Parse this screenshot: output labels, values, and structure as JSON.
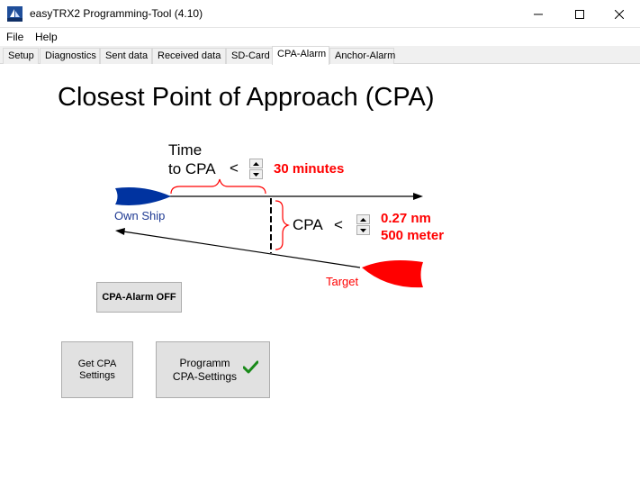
{
  "window": {
    "title": "easyTRX2 Programming-Tool (4.10)",
    "icon": "trx-app-icon"
  },
  "menu": [
    "File",
    "Help"
  ],
  "tabs": [
    {
      "label": "Setup",
      "active": false
    },
    {
      "label": "Diagnostics",
      "active": false
    },
    {
      "label": "Sent data",
      "active": false
    },
    {
      "label": "Received data",
      "active": false
    },
    {
      "label": "SD-Card",
      "active": false
    },
    {
      "label": "CPA-Alarm",
      "active": true
    },
    {
      "label": "Anchor-Alarm",
      "active": false
    }
  ],
  "cpa": {
    "heading": "Closest Point of Approach (CPA)",
    "time_label_line1": "Time",
    "time_label_line2": "to CPA",
    "time_operator": "<",
    "time_value": "30 minutes",
    "cpa_label": "CPA",
    "cpa_operator": "<",
    "cpa_value_nm": "0.27 nm",
    "cpa_value_m": "500 meter",
    "own_ship_label": "Own Ship",
    "target_label": "Target"
  },
  "buttons": {
    "alarm_toggle": "CPA-Alarm OFF",
    "get_settings_line1": "Get CPA",
    "get_settings_line2": "Settings",
    "program_line1": "Programm",
    "program_line2": "CPA-Settings"
  },
  "colors": {
    "own_ship": "#0033a0",
    "own_ship_label": "#1f3a93",
    "target": "#ff0000",
    "value_text": "#ff0000",
    "check": "#1a8a1a"
  }
}
